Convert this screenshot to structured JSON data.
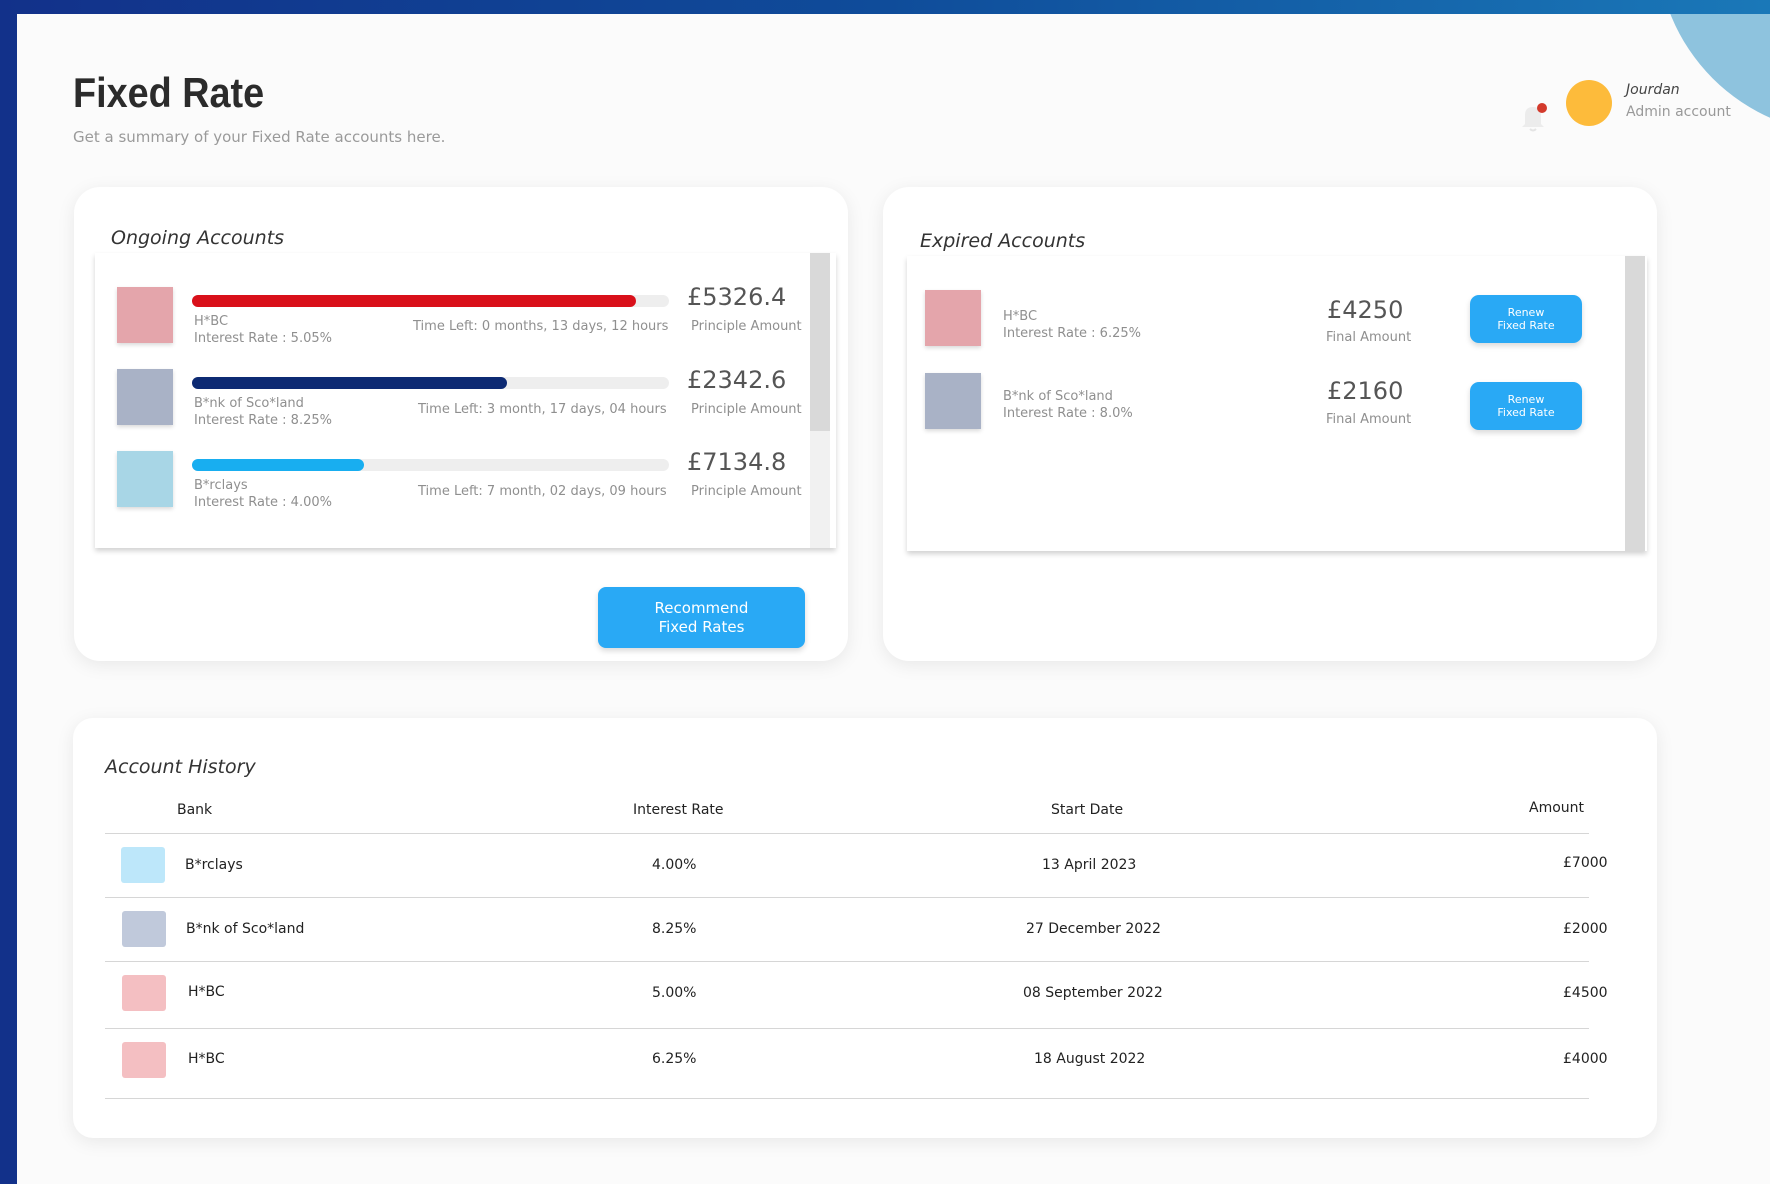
{
  "header": {
    "title": "Fixed Rate",
    "subtitle": "Get a summary of your Fixed Rate accounts here.",
    "user": {
      "name": "Jourdan",
      "role": "Admin account"
    },
    "notification_badge_color": "#d33a2c"
  },
  "ongoing": {
    "title": "Ongoing Accounts",
    "accounts": [
      {
        "bank": "H*BC",
        "rate": "Interest Rate : 5.05%",
        "time_left": "Time Left: 0 months, 13 days, 12 hours",
        "amount": "£5326.4",
        "amount_label": "Principle Amount",
        "progress": 0.93,
        "bar_color": "#d9101a",
        "swatch_color": "#e4a5ab"
      },
      {
        "bank": "B*nk of Sco*land",
        "rate": "Interest Rate : 8.25%",
        "time_left": "Time Left: 3 month, 17 days, 04 hours",
        "amount": "£2342.6",
        "amount_label": "Principle Amount",
        "progress": 0.66,
        "bar_color": "#0d2a73",
        "swatch_color": "#a9b2c6"
      },
      {
        "bank": "B*rclays",
        "rate": "Interest Rate : 4.00%",
        "time_left": "Time Left: 7 month, 02 days, 09 hours",
        "amount": "£7134.8",
        "amount_label": "Principle Amount",
        "progress": 0.36,
        "bar_color": "#18aef0",
        "swatch_color": "#a8d6e6"
      }
    ],
    "recommend_button": {
      "line1": "Recommend",
      "line2": "Fixed Rates"
    }
  },
  "expired": {
    "title": "Expired Accounts",
    "accounts": [
      {
        "bank": "H*BC",
        "rate": "Interest Rate : 6.25%",
        "amount": "£4250",
        "amount_label": "Final Amount",
        "button_line1": "Renew",
        "button_line2": "Fixed Rate",
        "swatch_color": "#e4a5ab"
      },
      {
        "bank": "B*nk of Sco*land",
        "rate": "Interest Rate : 8.0%",
        "amount": "£2160",
        "amount_label": "Final Amount",
        "button_line1": "Renew",
        "button_line2": "Fixed Rate",
        "swatch_color": "#a9b2c6"
      }
    ]
  },
  "history": {
    "title": "Account History",
    "columns": [
      "Bank",
      "Interest Rate",
      "Start Date",
      "Amount"
    ],
    "rows": [
      {
        "bank": "B*rclays",
        "rate": "4.00%",
        "date": "13 April 2023",
        "amount": "£7000",
        "swatch_color": "#bde7fa"
      },
      {
        "bank": "B*nk of Sco*land",
        "rate": "8.25%",
        "date": "27 December 2022",
        "amount": "£2000",
        "swatch_color": "#c0c9db"
      },
      {
        "bank": "H*BC",
        "rate": "5.00%",
        "date": "08 September 2022",
        "amount": "£4500",
        "swatch_color": "#f4bfc2"
      },
      {
        "bank": "H*BC",
        "rate": "6.25%",
        "date": "18 August 2022",
        "amount": "£4000",
        "swatch_color": "#f4bfc2"
      }
    ]
  }
}
